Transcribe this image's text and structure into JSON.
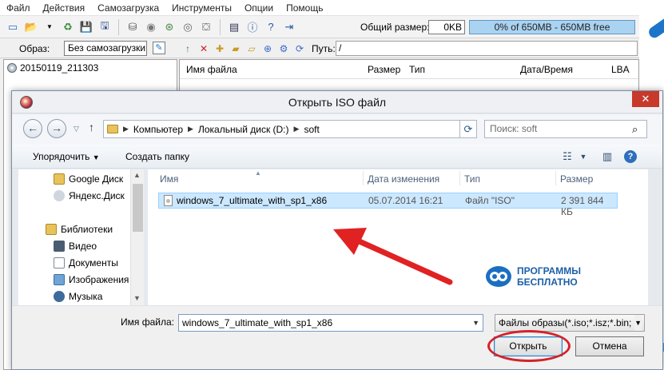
{
  "app": {
    "menu": [
      "Файл",
      "Действия",
      "Самозагрузка",
      "Инструменты",
      "Опции",
      "Помощь"
    ],
    "total_size_label": "Общий размер:",
    "total_size_value": "0KB",
    "capacity_text": "0% of 650MB - 650MB free",
    "image_label": "Образ:",
    "boot_label": "Без самозагрузки",
    "path_label": "Путь:",
    "path_value": "/",
    "tree_item": "20150119_211303",
    "list_headers": [
      "Имя файла",
      "Размер",
      "Тип",
      "Дата/Время",
      "LBA"
    ]
  },
  "dialog": {
    "title": "Открыть ISO файл",
    "breadcrumb": [
      "Компьютер",
      "Локальный диск (D:)",
      "soft"
    ],
    "search_placeholder": "Поиск: soft",
    "organize_label": "Упорядочить",
    "new_folder_label": "Создать папку",
    "nav_items": [
      {
        "label": "Google Диск",
        "icon": "google-drive-icon"
      },
      {
        "label": "Яндекс.Диск",
        "icon": "yandex-disk-icon"
      },
      {
        "label": "Библиотеки",
        "icon": "libraries-icon"
      },
      {
        "label": "Видео",
        "icon": "video-icon"
      },
      {
        "label": "Документы",
        "icon": "documents-icon"
      },
      {
        "label": "Изображения",
        "icon": "images-icon"
      },
      {
        "label": "Музыка",
        "icon": "music-icon"
      }
    ],
    "columns": [
      "Имя",
      "Дата изменения",
      "Тип",
      "Размер"
    ],
    "files": [
      {
        "name": "windows_7_ultimate_with_sp1_x86",
        "date": "05.07.2014 16:21",
        "type": "Файл \"ISO\"",
        "size": "2 391 844 КБ"
      }
    ],
    "logo_line1": "ПРОГРАММЫ",
    "logo_line2": "БЕСПЛАТНО",
    "filename_label": "Имя файла:",
    "filename_value": "windows_7_ultimate_with_sp1_x86",
    "filter_value": "Файлы образы(*.iso;*.isz;*.bin;",
    "open_label": "Открыть",
    "cancel_label": "Отмена"
  },
  "colors": {
    "accent_red": "#d3222a",
    "selection": "#cce8ff",
    "capacity": "#aad3f2"
  }
}
